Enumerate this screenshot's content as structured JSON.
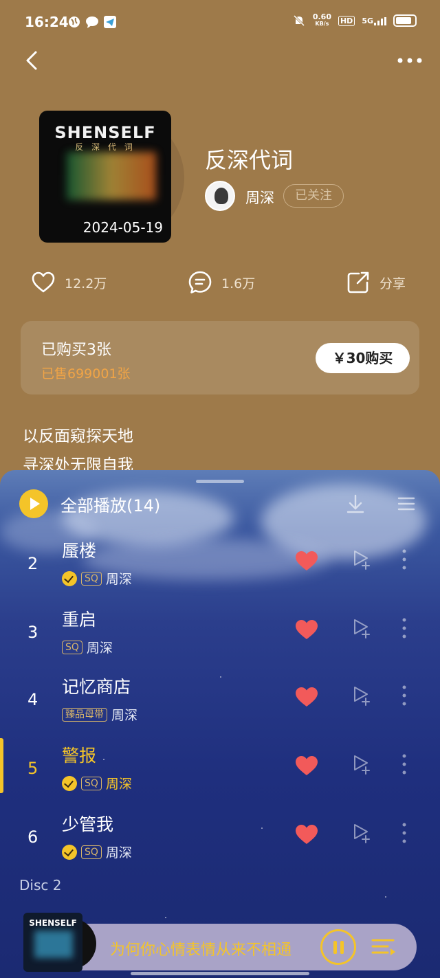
{
  "status_bar": {
    "time": "16:24",
    "net_speed": "0.60\nKB/s",
    "net_speed_top": "0.60",
    "net_speed_bottom": "KB/s",
    "hd": "HD",
    "signal": "5G"
  },
  "album": {
    "cover_title": "SHENSELF",
    "cover_subtitle": "反 深 代 词",
    "date": "2024-05-19",
    "title": "反深代词",
    "artist": "周深",
    "follow_label": "已关注"
  },
  "actions": {
    "likes": "12.2万",
    "comments": "1.6万",
    "share": "分享"
  },
  "purchase": {
    "bought": "已购买3张",
    "sold": "已售699001张",
    "buy_label": "￥30购买"
  },
  "description": [
    "以反面窥探天地",
    "寻深处无限自我"
  ],
  "playlist": {
    "play_all": "全部播放(14)",
    "tracks": [
      {
        "num": "2",
        "title": "蜃楼",
        "vip": true,
        "tag": "SQ",
        "artist": "周深",
        "active": false
      },
      {
        "num": "3",
        "title": "重启",
        "vip": false,
        "tag": "SQ",
        "artist": "周深",
        "active": false
      },
      {
        "num": "4",
        "title": "记忆商店",
        "vip": false,
        "tag": "臻品母带",
        "artist": "周深",
        "active": false
      },
      {
        "num": "5",
        "title": "警报",
        "vip": true,
        "tag": "SQ",
        "artist": "周深",
        "active": true
      },
      {
        "num": "6",
        "title": "少管我",
        "vip": true,
        "tag": "SQ",
        "artist": "周深",
        "active": false
      }
    ],
    "disc_label": "Disc 2"
  },
  "mini_player": {
    "cover_title": "SHENSELF",
    "lyric": "为何你心情表情从来不相通"
  },
  "colors": {
    "background": "#9e7a4a",
    "accent": "#f4c429",
    "heart": "#f25a5a",
    "sold": "#f0a446"
  }
}
